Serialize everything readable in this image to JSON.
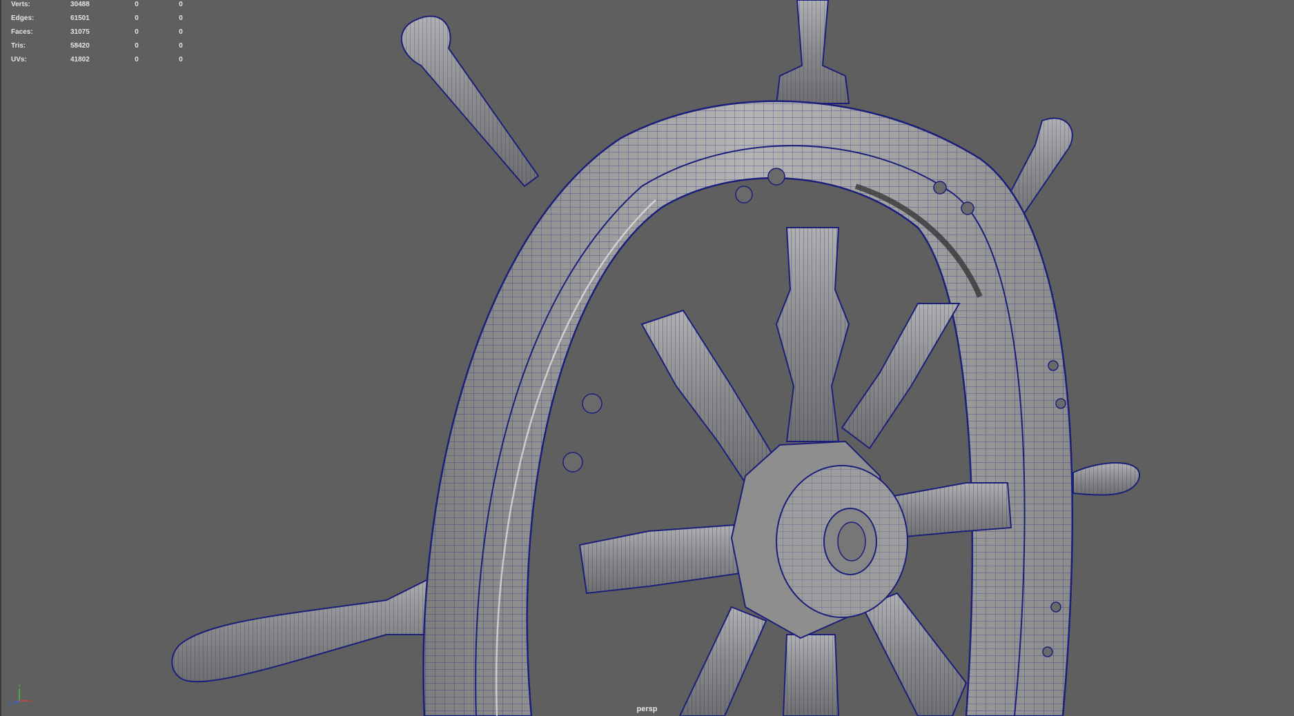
{
  "viewport": {
    "camera": "persp"
  },
  "hud": {
    "rows": [
      {
        "label": "Verts:",
        "total": "30488",
        "selected": "0",
        "component": "0"
      },
      {
        "label": "Edges:",
        "total": "61501",
        "selected": "0",
        "component": "0"
      },
      {
        "label": "Faces:",
        "total": "31075",
        "selected": "0",
        "component": "0"
      },
      {
        "label": "Tris:",
        "total": "58420",
        "selected": "0",
        "component": "0"
      },
      {
        "label": "UVs:",
        "total": "41802",
        "selected": "0",
        "component": "0"
      }
    ]
  },
  "axis": {
    "x": "X",
    "y": "Y",
    "z": "Z"
  },
  "colors": {
    "background": "#5f5f5f",
    "wireframe": "#1a1f7a",
    "shaded": "#9a9a9a",
    "axis_x": "#d04040",
    "axis_y": "#40c040",
    "axis_z": "#4060e0"
  }
}
